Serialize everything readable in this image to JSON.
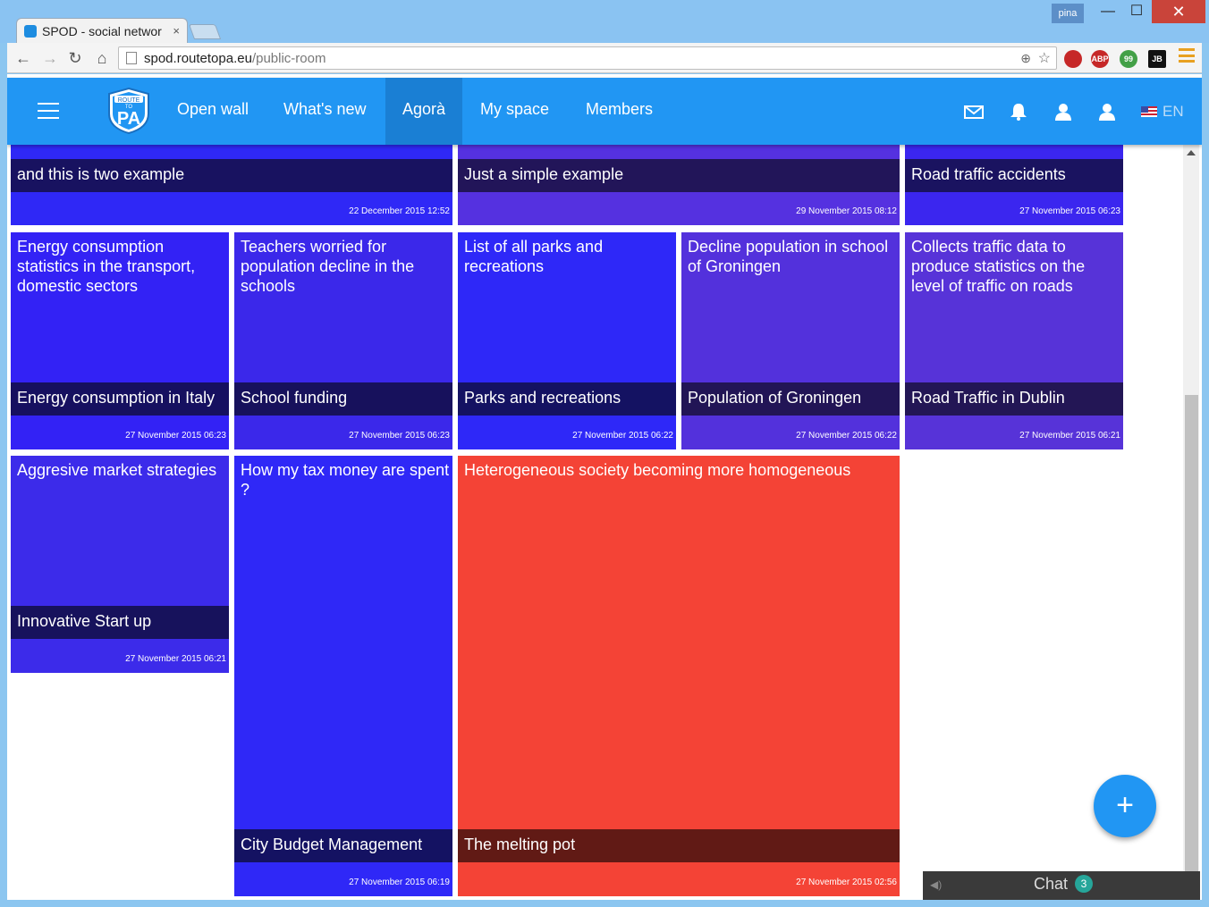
{
  "browser": {
    "tab_title": "SPOD - social networ",
    "tab_close": "×",
    "profile": "pina",
    "window_buttons": {
      "minimize": "—",
      "maximize": "☐",
      "close": "✕"
    },
    "url_host": "spod.routetopa.eu",
    "url_path": "/public-room",
    "nav": {
      "back": "←",
      "forward": "→",
      "reload": "↻",
      "home": "⌂"
    },
    "extensions": [
      {
        "name": "record-extension-icon",
        "label": "",
        "color": "#c62828"
      },
      {
        "name": "adblock-icon",
        "label": "ABP",
        "color": "#c62828"
      },
      {
        "name": "quote-extension-icon",
        "label": "99",
        "color": "#43a047"
      },
      {
        "name": "jetbrains-icon",
        "label": "JB",
        "color": "#111111"
      }
    ]
  },
  "app": {
    "logo_text_top": "ROUTE",
    "logo_text_mid": "TO",
    "logo_text_main": "PA",
    "nav": [
      "Open wall",
      "What's new",
      "Agorà",
      "My space",
      "Members"
    ],
    "active_nav": "Agorà",
    "lang": "EN",
    "accent": "#2196f3"
  },
  "tiles": {
    "row1": [
      {
        "band": "and this is two example",
        "date": "22 December 2015 12:52",
        "color": "#2f28f6"
      },
      {
        "band": "Just a simple example",
        "date": "29 November 2015 08:12",
        "color": "#5531e0"
      },
      {
        "band": "Road traffic accidents",
        "date": "27 November 2015 06:23",
        "color": "#3b26ef"
      }
    ],
    "row2": [
      {
        "desc": "Energy consumption statistics in the transport, domestic sectors",
        "band": "Energy consumption in Italy",
        "date": "27 November 2015 06:23",
        "color": "#3322f5"
      },
      {
        "desc": "Teachers worried for population decline in the schools",
        "band": "School funding",
        "date": "27 November 2015 06:23",
        "color": "#3b28ea"
      },
      {
        "desc": "List of all parks and recreations",
        "band": "Parks and recreations",
        "date": "27 November 2015 06:22",
        "color": "#2e28f8"
      },
      {
        "desc": "Decline population in school of Groningen",
        "band": "Population of Groningen",
        "date": "27 November 2015 06:22",
        "color": "#5331dc"
      },
      {
        "desc": "Collects traffic data to produce statistics on the level of traffic on roads",
        "band": "Road Traffic in Dublin",
        "date": "27 November 2015 06:21",
        "color": "#5733d8"
      }
    ],
    "row3": [
      {
        "desc": "Aggresive market strategies",
        "band": "Innovative Start up",
        "date": "27 November 2015 06:21",
        "color": "#3c2bea"
      },
      {
        "desc": "How my tax money are spent ?",
        "band": "City Budget Management",
        "date": "27 November 2015 06:19",
        "color": "#2f28f7"
      },
      {
        "desc": "Heterogeneous society becoming more homogeneous",
        "band": "The melting pot",
        "date": "27 November 2015 02:56",
        "color": "#f44336"
      }
    ]
  },
  "fab": "+",
  "chat": {
    "label": "Chat",
    "count": "3"
  }
}
